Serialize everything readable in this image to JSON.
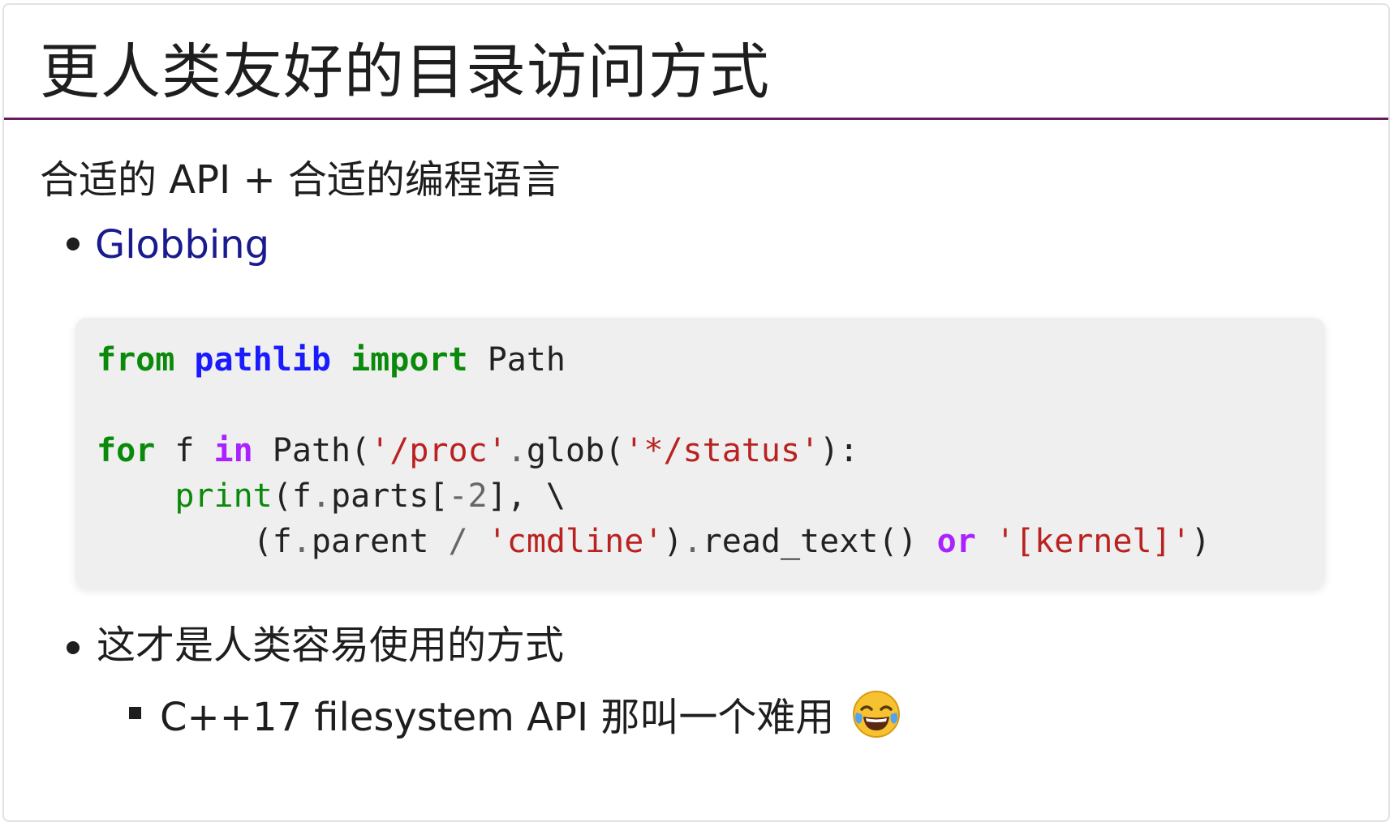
{
  "title": "更人类友好的目录访问方式",
  "subtitle": "合适的 API + 合适的编程语言",
  "bullets": [
    {
      "text": "Globbing"
    },
    {
      "text": "这才是人类容易使用的方式"
    }
  ],
  "sub_bullet": {
    "text": "C++17 filesystem API 那叫一个难用"
  },
  "code": {
    "line1": {
      "kw_from": "from",
      "module": "pathlib",
      "kw_import": "import",
      "name": "Path"
    },
    "line3": {
      "kw_for": "for",
      "var": "f",
      "kw_in": "in",
      "call1": "Path(",
      "str1": "'/proc'",
      "dot1": ".",
      "call2": "glob(",
      "str2": "'*/status'",
      "close": "):"
    },
    "line4": {
      "builtin": "print",
      "open": "(f",
      "dot": ".",
      "attr": "parts[",
      "num": "-2",
      "rest": "], \\"
    },
    "line5": {
      "open": "(f",
      "dot1": ".",
      "attr": "parent ",
      "slash": "/",
      "space": " ",
      "str1": "'cmdline'",
      "close1": ")",
      "dot2": ".",
      "call": "read_text() ",
      "kw_or": "or",
      "space2": " ",
      "str2": "'[kernel]'",
      "close2": ")"
    }
  },
  "colors": {
    "title_rule": "#6a1b63",
    "link": "#1a1a8f",
    "keyword": "#0a8a0a",
    "module": "#1a1aff",
    "keyword_operator": "#aa22ff",
    "string": "#ba2121",
    "code_bg": "#efefef"
  },
  "icons": {
    "emoji": "face-with-tears-of-joy-icon"
  }
}
